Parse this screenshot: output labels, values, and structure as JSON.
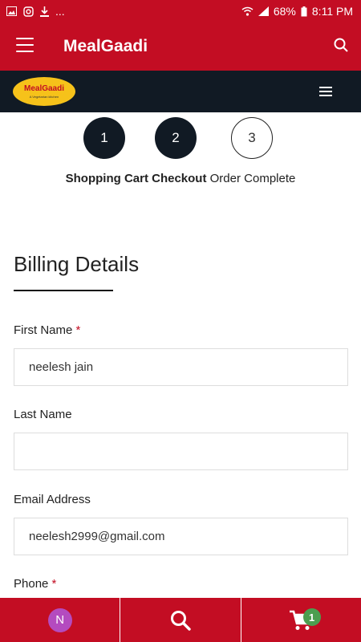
{
  "status_bar": {
    "icons_left": [
      "image-icon",
      "instagram-icon",
      "download-icon",
      "more-dots"
    ],
    "more": "...",
    "battery": "68%",
    "time": "8:11 PM"
  },
  "app_bar": {
    "title": "MealGaadi"
  },
  "site_header": {
    "logo_text": "MealGaadi",
    "logo_subtext": "A Vegetarian kitchen"
  },
  "steps": [
    {
      "number": "1",
      "label": "Shopping Cart",
      "state": "complete"
    },
    {
      "number": "2",
      "label": "Checkout",
      "state": "complete"
    },
    {
      "number": "3",
      "label": "Order Complete",
      "state": "pending"
    }
  ],
  "billing": {
    "title": "Billing Details",
    "fields": {
      "first_name": {
        "label": "First Name",
        "required_mark": "*",
        "value": "neelesh jain"
      },
      "last_name": {
        "label": "Last Name",
        "value": ""
      },
      "email": {
        "label": "Email Address",
        "value": "neelesh2999@gmail.com"
      },
      "phone": {
        "label": "Phone",
        "required_mark": "*"
      }
    }
  },
  "bottom_nav": {
    "avatar_initial": "N",
    "cart_count": "1"
  },
  "colors": {
    "brand_red": "#c30d23",
    "dark_header": "#111a24",
    "badge_green": "#4c9e50",
    "avatar_purple": "#b44bbf"
  }
}
